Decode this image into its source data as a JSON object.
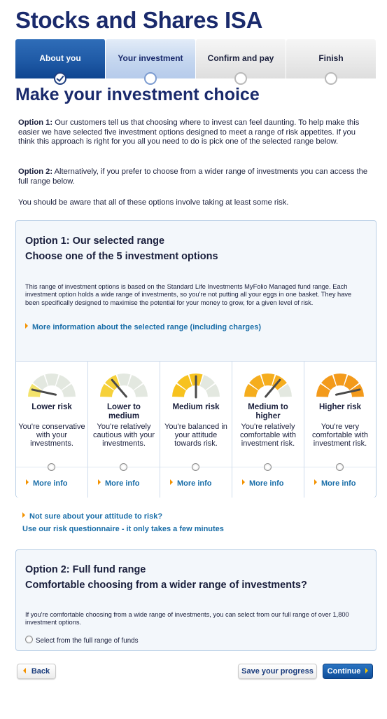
{
  "header": {
    "title": "Stocks and Shares ISA"
  },
  "steps": [
    {
      "label": "About you",
      "state": "done"
    },
    {
      "label": "Your investment",
      "state": "active"
    },
    {
      "label": "Confirm and pay",
      "state": "todo"
    },
    {
      "label": "Finish",
      "state": "todo"
    }
  ],
  "main": {
    "heading": "Make your investment choice",
    "option1_intro_label": "Option 1:",
    "option1_intro_text": "Our customers tell us that choosing where to invest can feel daunting. To help make this easier we have selected five investment options designed to meet a range of risk appetites. If you think this approach is right for you all you need to do is pick one of the selected range below.",
    "option2_intro_label": "Option 2:",
    "option2_intro_text": "Alternatively, if you prefer to choose from a wider range of investments you can access the full range below.",
    "risk_warning": "You should be aware that all of these options involve taking at least some risk."
  },
  "option1_panel": {
    "title": "Option 1: Our selected range",
    "subtitle": "Choose one of the 5 investment options",
    "description": "This range of investment options is based on the Standard Life Investments MyFolio Managed fund range. Each investment option holds a wide range of investments, so you're not putting all your eggs in one basket. They have been specifically designed to maximise the potential for your money to grow, for a given level of risk.",
    "more_info_link": "More information about the selected range (including charges)",
    "options": [
      {
        "name": "Lower risk",
        "description": "You're conservative with your investments.",
        "more_info": "More info",
        "level": 1
      },
      {
        "name": "Lower to medium",
        "description": "You're relatively cautious with your investments.",
        "more_info": "More info",
        "level": 2
      },
      {
        "name": "Medium risk",
        "description": "You're balanced in your attitude towards risk.",
        "more_info": "More info",
        "level": 3
      },
      {
        "name": "Medium to higher",
        "description": "You're relatively comfortable with investment risk.",
        "more_info": "More info",
        "level": 4
      },
      {
        "name": "Higher risk",
        "description": "You're very comfortable with investment risk.",
        "more_info": "More info",
        "level": 5
      }
    ]
  },
  "attitude": {
    "question_link": "Not sure about your attitude to risk?",
    "questionnaire_link": "Use our risk questionnaire - it only takes a few minutes"
  },
  "option2_panel": {
    "title": "Option 2: Full fund range",
    "subtitle": "Comfortable choosing from a wider range of investments?",
    "description": "If you're comfortable choosing from a wide range of investments, you can select from our full range of over 1,800 investment options.",
    "radio_label": "Select from the full range of funds"
  },
  "footer": {
    "back_label": "Back",
    "save_label": "Save your progress",
    "continue_label": "Continue"
  },
  "colors": {
    "brand_navy": "#1a2a6c",
    "link_blue": "#1a6ea8",
    "accent_orange": "#f39200",
    "gauge_levels": [
      "#f3e36b",
      "#f6d13a",
      "#f7c21e",
      "#f5ad1d",
      "#f39a1b"
    ]
  }
}
